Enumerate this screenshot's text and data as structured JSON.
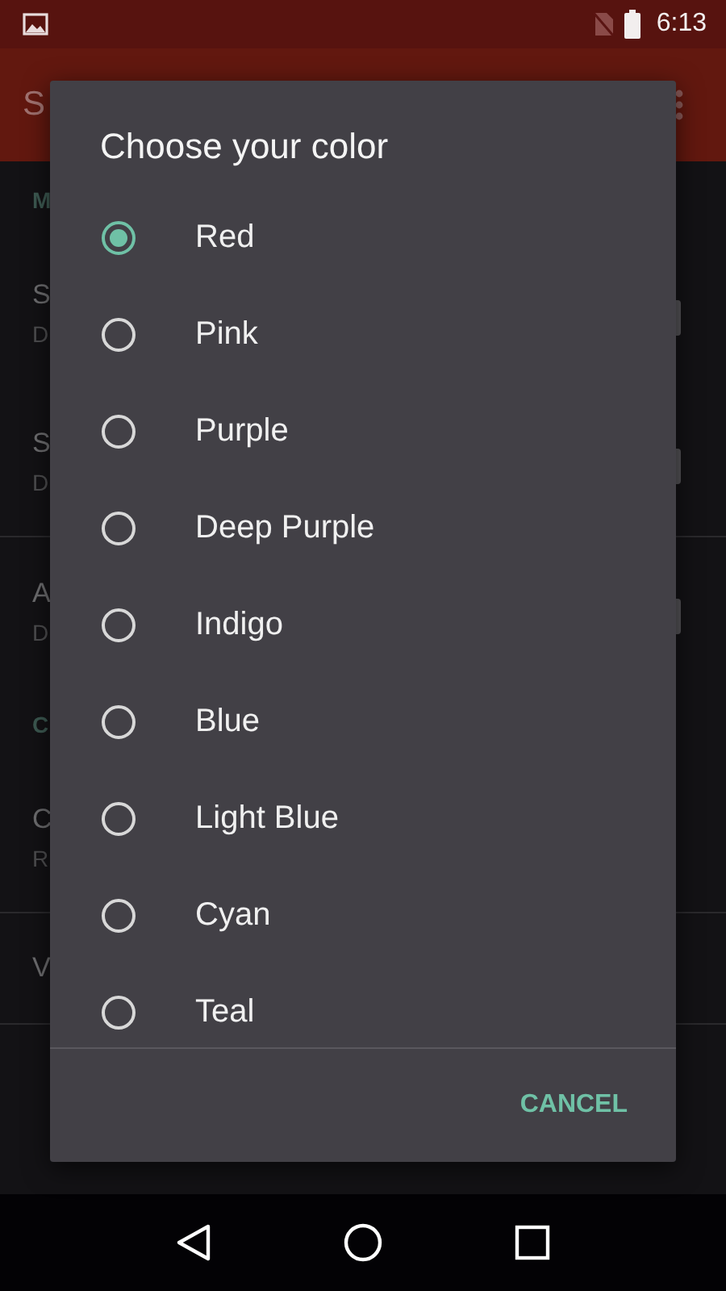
{
  "status_bar": {
    "time": "6:13"
  },
  "toolbar": {
    "title": "S"
  },
  "settings": [
    {
      "kind": "header",
      "title": "M"
    },
    {
      "kind": "item",
      "title": "S",
      "summary": "D",
      "switch": true
    },
    {
      "kind": "item",
      "title": "S",
      "summary": "D",
      "switch": true,
      "divider": true
    },
    {
      "kind": "item",
      "title": "A",
      "summary": "D",
      "switch": true
    },
    {
      "kind": "header",
      "title": "C"
    },
    {
      "kind": "item",
      "title": "C",
      "summary": "R",
      "divider": true
    },
    {
      "kind": "single",
      "title": "V",
      "divider": true
    }
  ],
  "dialog": {
    "title": "Choose your color",
    "options": [
      {
        "label": "Red",
        "selected": true
      },
      {
        "label": "Pink",
        "selected": false
      },
      {
        "label": "Purple",
        "selected": false
      },
      {
        "label": "Deep Purple",
        "selected": false
      },
      {
        "label": "Indigo",
        "selected": false
      },
      {
        "label": "Blue",
        "selected": false
      },
      {
        "label": "Light Blue",
        "selected": false
      },
      {
        "label": "Cyan",
        "selected": false
      },
      {
        "label": "Teal",
        "selected": false
      }
    ],
    "button": "CANCEL"
  }
}
